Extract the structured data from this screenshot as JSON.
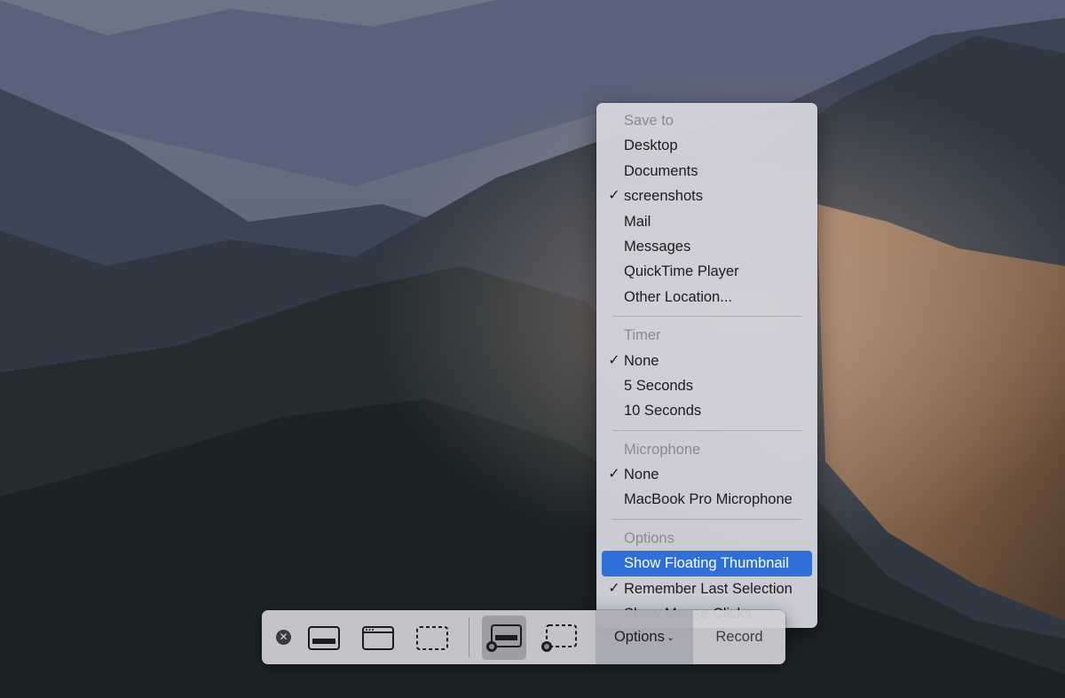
{
  "menu": {
    "sections": [
      {
        "header": "Save to",
        "items": [
          {
            "label": "Desktop",
            "checked": false
          },
          {
            "label": "Documents",
            "checked": false
          },
          {
            "label": "screenshots",
            "checked": true
          },
          {
            "label": "Mail",
            "checked": false
          },
          {
            "label": "Messages",
            "checked": false
          },
          {
            "label": "QuickTime Player",
            "checked": false
          },
          {
            "label": "Other Location...",
            "checked": false
          }
        ]
      },
      {
        "header": "Timer",
        "items": [
          {
            "label": "None",
            "checked": true
          },
          {
            "label": "5 Seconds",
            "checked": false
          },
          {
            "label": "10 Seconds",
            "checked": false
          }
        ]
      },
      {
        "header": "Microphone",
        "items": [
          {
            "label": "None",
            "checked": true
          },
          {
            "label": "MacBook Pro Microphone",
            "checked": false
          }
        ]
      },
      {
        "header": "Options",
        "items": [
          {
            "label": "Show Floating Thumbnail",
            "checked": false,
            "selected": true
          },
          {
            "label": "Remember Last Selection",
            "checked": true
          },
          {
            "label": "Show Mouse Clicks",
            "checked": false
          }
        ]
      }
    ],
    "check_glyph": "✓"
  },
  "toolbar": {
    "close_glyph": "✕",
    "buttons": [
      {
        "name": "capture-entire-screen-icon",
        "active": false
      },
      {
        "name": "capture-selected-window-icon",
        "active": false
      },
      {
        "name": "capture-selected-portion-icon",
        "active": false
      },
      {
        "name": "record-entire-screen-icon",
        "active": true
      },
      {
        "name": "record-selected-portion-icon",
        "active": false
      }
    ],
    "options_label": "Options",
    "options_chevron": "⌄",
    "record_label": "Record"
  },
  "colors": {
    "highlight": "#2e6fd8",
    "menu_bg": "#d6d6de",
    "toolbar_bg": "#d0d0d6"
  }
}
